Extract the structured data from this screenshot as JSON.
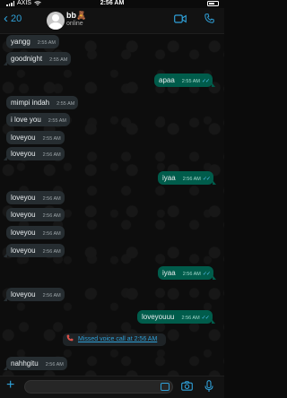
{
  "status_bar": {
    "carrier": "AXIS",
    "time": "2:56 AM"
  },
  "header": {
    "back_count": "20",
    "contact_name": "bb🧸",
    "contact_status": "online"
  },
  "messages": [
    {
      "text": "yangg",
      "time": "2:55 AM",
      "dir": "in"
    },
    {
      "text": "goodnight",
      "time": "2:55 AM",
      "dir": "in"
    },
    {
      "text": "apaa",
      "time": "2:55 AM",
      "dir": "out"
    },
    {
      "text": "mimpi indah",
      "time": "2:55 AM",
      "dir": "in"
    },
    {
      "text": "i love you",
      "time": "2:55 AM",
      "dir": "in"
    },
    {
      "text": "loveyou",
      "time": "2:55 AM",
      "dir": "in"
    },
    {
      "text": "loveyou",
      "time": "2:56 AM",
      "dir": "in"
    },
    {
      "text": "iyaa",
      "time": "2:56 AM",
      "dir": "out"
    },
    {
      "text": "loveyou",
      "time": "2:56 AM",
      "dir": "in"
    },
    {
      "text": "loveyou",
      "time": "2:56 AM",
      "dir": "in"
    },
    {
      "text": "loveyou",
      "time": "2:56 AM",
      "dir": "in"
    },
    {
      "text": "loveyou",
      "time": "2:56 AM",
      "dir": "in"
    },
    {
      "text": "iyaa",
      "time": "2:56 AM",
      "dir": "out"
    },
    {
      "text": "loveyou",
      "time": "2:56 AM",
      "dir": "in"
    },
    {
      "text": "loveyouuu",
      "time": "2:56 AM",
      "dir": "out"
    },
    {
      "text": "nahhgitu",
      "time": "2:56 AM",
      "dir": "in"
    }
  ],
  "missed_call": {
    "label": "Missed voice call at 2:56 AM"
  },
  "colors": {
    "accent": "#2fa0d8",
    "incoming_bubble": "#262d31",
    "outgoing_bubble": "#005c4b",
    "read_ticks": "#53bdeb",
    "missed_call_icon": "#e0524a"
  },
  "icons": [
    "back-chevron-icon",
    "video-call-icon",
    "voice-call-icon",
    "plus-icon",
    "sticker-icon",
    "camera-icon",
    "microphone-icon"
  ]
}
